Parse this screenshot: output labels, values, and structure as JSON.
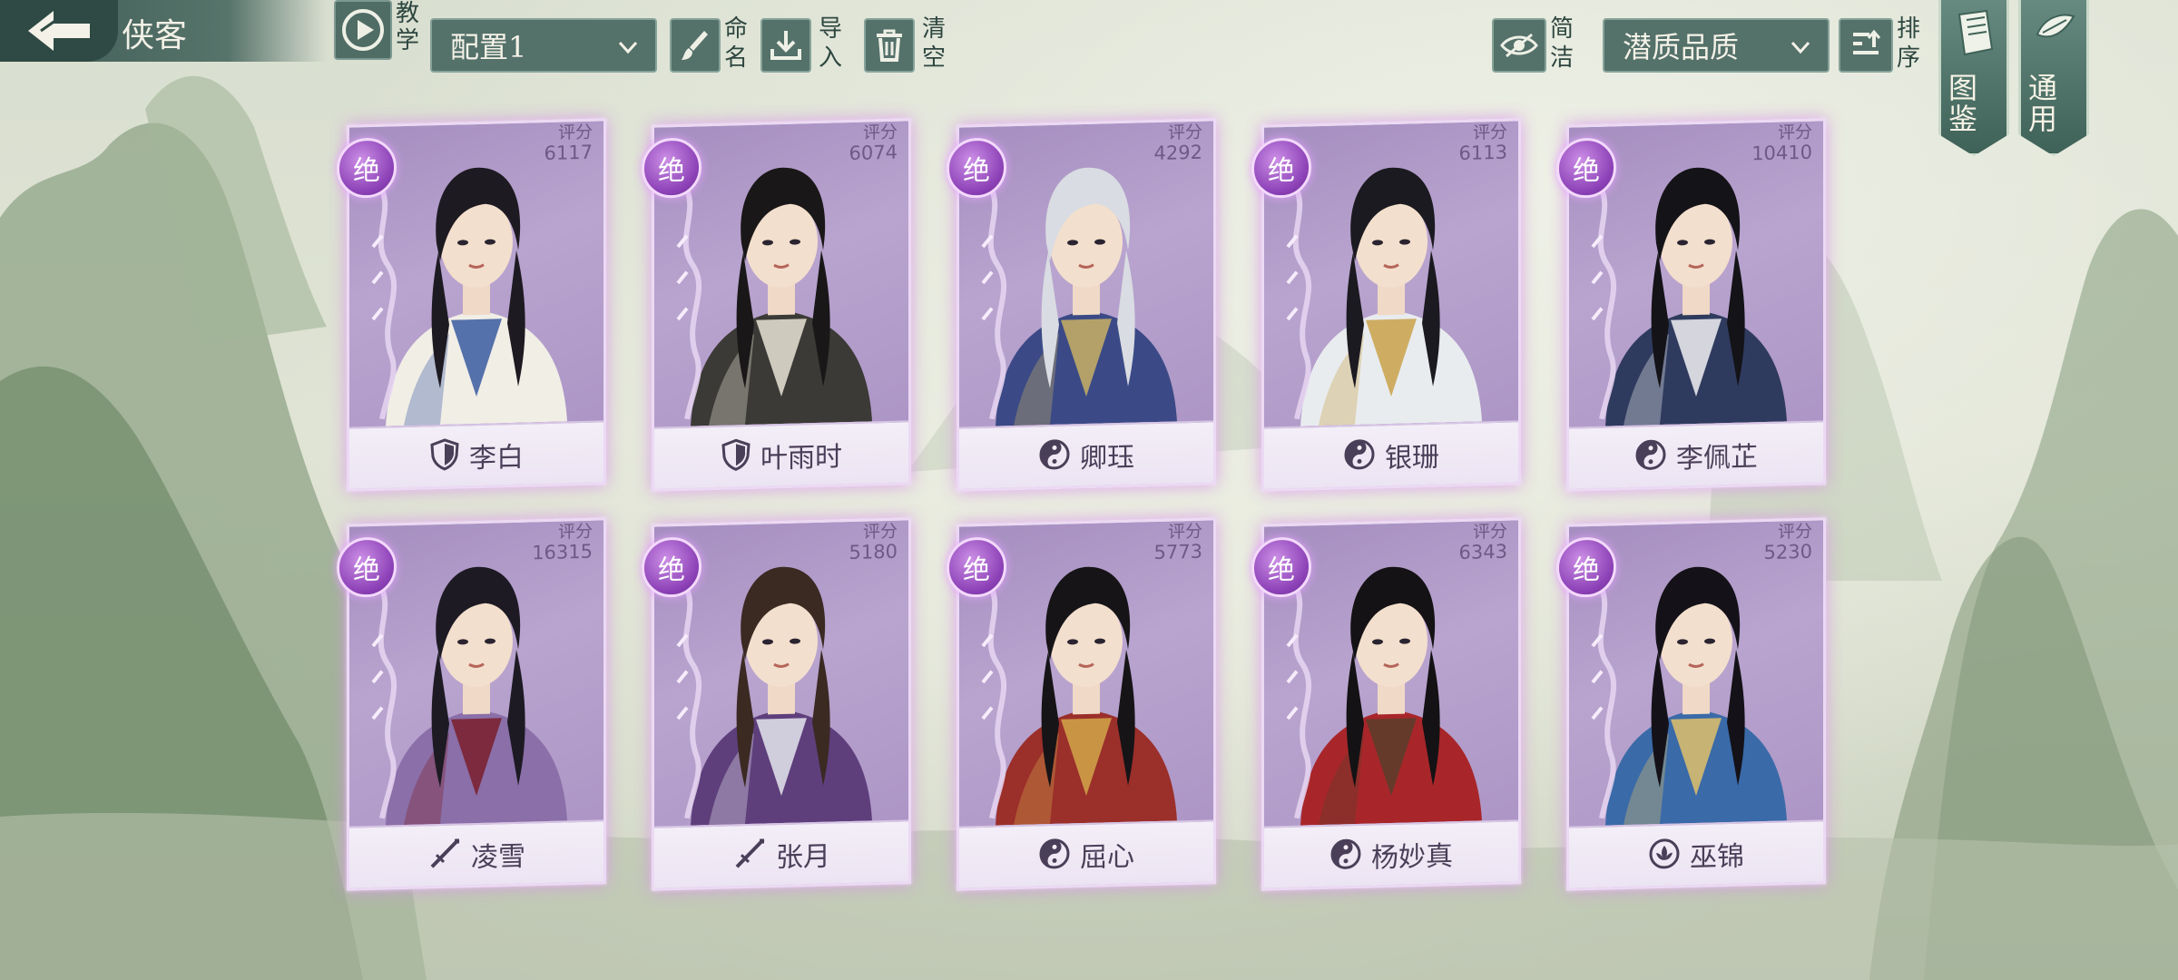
{
  "header": {
    "title": "侠客",
    "tutorial_label": "教学",
    "config_select": "配置1",
    "rename_label": "命名",
    "import_label": "导入",
    "clear_label": "清空",
    "simple_label": "简洁",
    "quality_select": "潜质品质",
    "sort_label": "排序"
  },
  "banners": [
    {
      "label": "图鉴"
    },
    {
      "label": "通用"
    }
  ],
  "score_label": "评分",
  "grade_label": "绝",
  "cards": [
    {
      "name": "李白",
      "score": "6117",
      "class_icon": "shield-icon",
      "colors": {
        "hair": "#1e1a22",
        "robe": "#f1eee6",
        "accent": "#3a5aa0"
      }
    },
    {
      "name": "叶雨时",
      "score": "6074",
      "class_icon": "shield-icon",
      "colors": {
        "hair": "#1a1718",
        "robe": "#3b3a36",
        "accent": "#e9e4d5"
      }
    },
    {
      "name": "卿珏",
      "score": "4292",
      "class_icon": "yinyang-icon",
      "colors": {
        "hair": "#d9dce2",
        "robe": "#3b4a86",
        "accent": "#c9b064"
      }
    },
    {
      "name": "银珊",
      "score": "6113",
      "class_icon": "yinyang-icon",
      "colors": {
        "hair": "#1b1a20",
        "robe": "#e9ecef",
        "accent": "#c9a24a"
      }
    },
    {
      "name": "李佩芷",
      "score": "10410",
      "class_icon": "yinyang-icon",
      "colors": {
        "hair": "#141318",
        "robe": "#2f3b5e",
        "accent": "#f1f1f3"
      }
    },
    {
      "name": "凌雪",
      "score": "16315",
      "class_icon": "sword-icon",
      "colors": {
        "hair": "#1d1a24",
        "robe": "#8a6fa8",
        "accent": "#7a1f2c"
      }
    },
    {
      "name": "张月",
      "score": "5180",
      "class_icon": "sword-icon",
      "colors": {
        "hair": "#3a2a22",
        "robe": "#5e3f7c",
        "accent": "#e4e6ee"
      }
    },
    {
      "name": "屈心",
      "score": "5773",
      "class_icon": "yinyang-icon",
      "colors": {
        "hair": "#161417",
        "robe": "#9b2f2a",
        "accent": "#d2a64a"
      }
    },
    {
      "name": "杨妙真",
      "score": "6343",
      "class_icon": "yinyang-icon",
      "colors": {
        "hair": "#141214",
        "robe": "#a8262a",
        "accent": "#5a3e2a"
      }
    },
    {
      "name": "巫锦",
      "score": "5230",
      "class_icon": "lotus-icon",
      "colors": {
        "hair": "#141218",
        "robe": "#3a6aa8",
        "accent": "#e0c06a"
      }
    }
  ]
}
